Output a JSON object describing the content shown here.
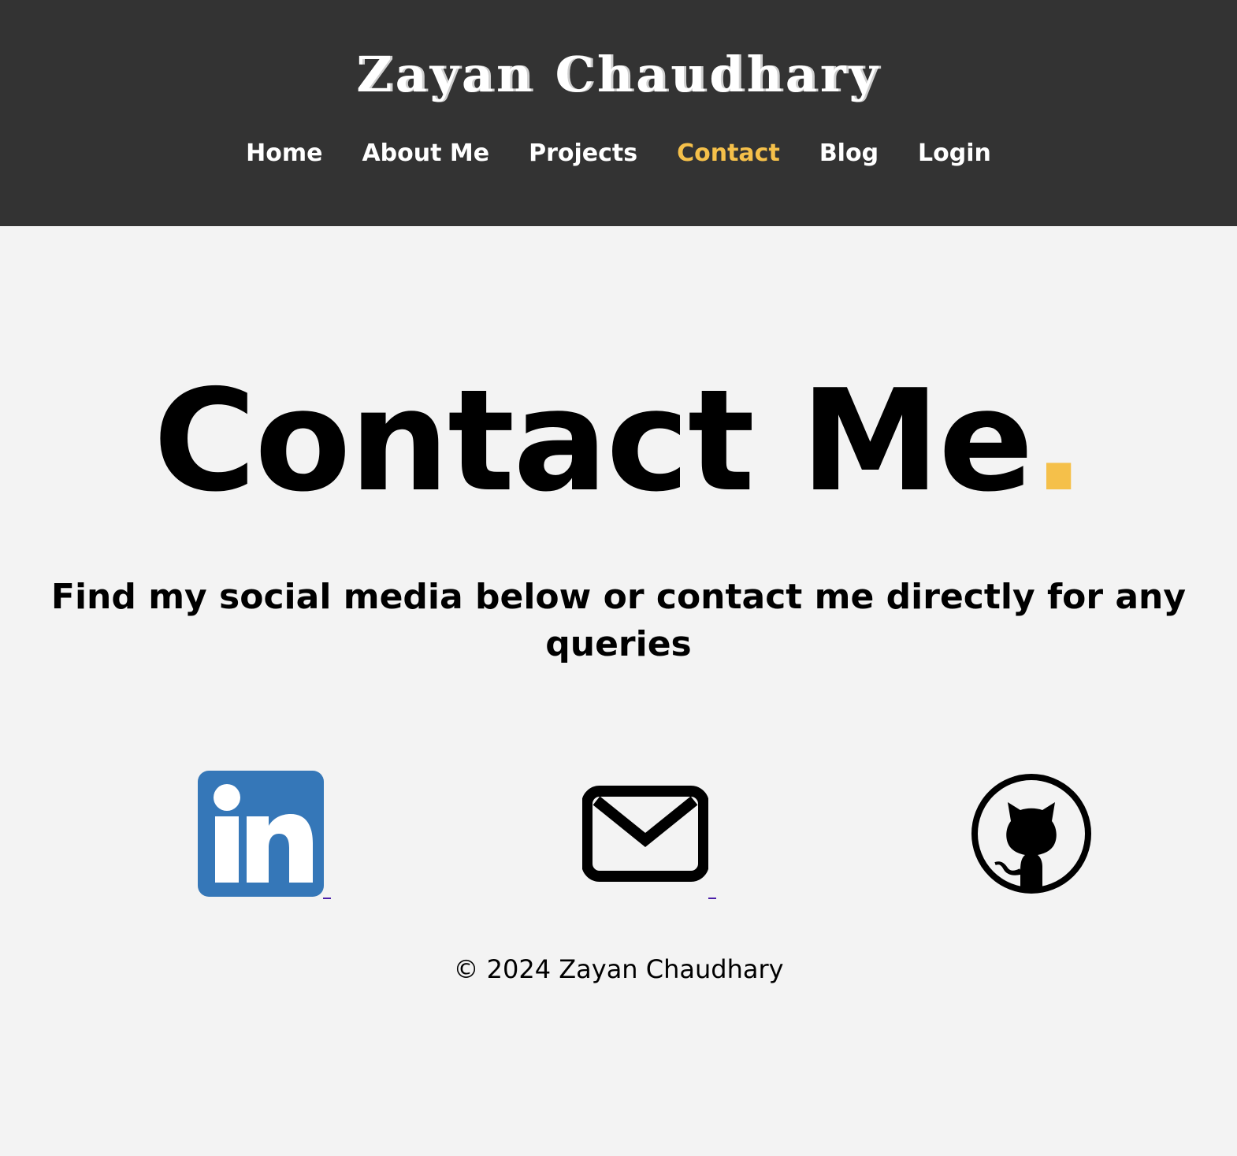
{
  "header": {
    "site_title": "Zayan Chaudhary",
    "nav": [
      {
        "label": "Home",
        "active": false
      },
      {
        "label": "About Me",
        "active": false
      },
      {
        "label": "Projects",
        "active": false
      },
      {
        "label": "Contact",
        "active": true
      },
      {
        "label": "Blog",
        "active": false
      },
      {
        "label": "Login",
        "active": false
      }
    ]
  },
  "main": {
    "heading": "Contact Me",
    "heading_accent": ".",
    "subtitle": "Find my social media below or contact me directly for any queries",
    "social_links": [
      {
        "icon": "linkedin-icon",
        "color": "#3577b8"
      },
      {
        "icon": "email-icon",
        "color": "#000000"
      },
      {
        "icon": "github-icon",
        "color": "#000000"
      }
    ]
  },
  "footer": {
    "copyright": "© 2024 Zayan Chaudhary"
  },
  "colors": {
    "header_bg": "#333333",
    "page_bg": "#f3f3f3",
    "accent": "#f5c04a",
    "linkedin": "#3577b8"
  }
}
